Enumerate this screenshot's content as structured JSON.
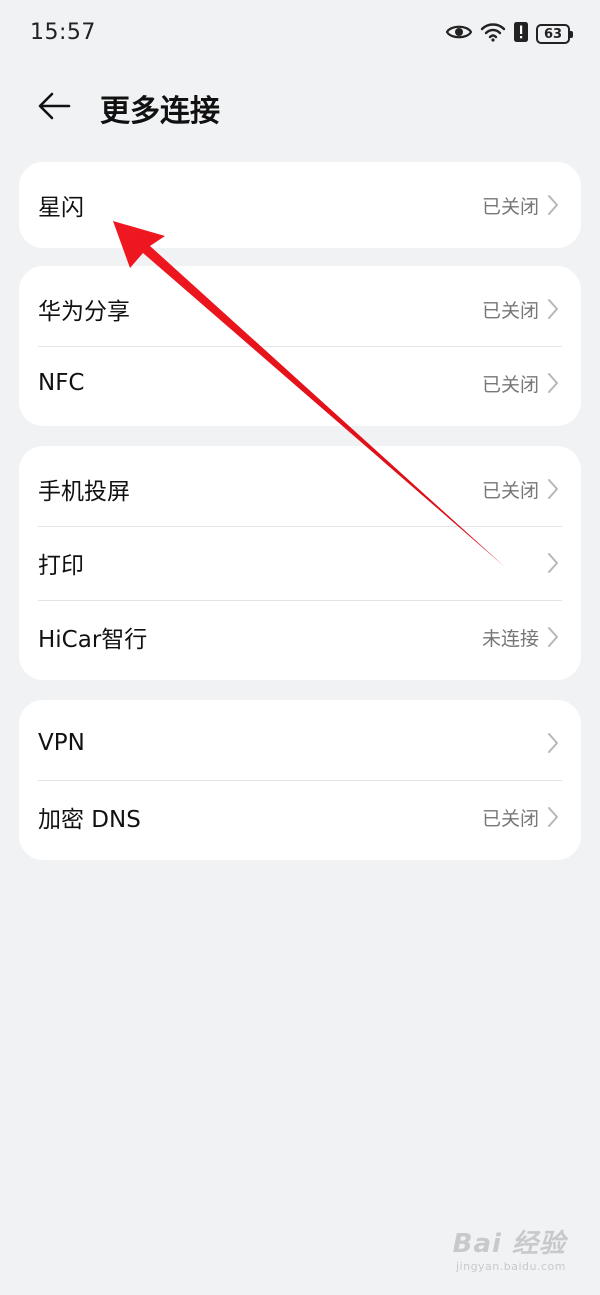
{
  "status_bar": {
    "time": "15:57",
    "battery": "63",
    "icons": [
      "eye-icon",
      "wifi-icon",
      "alert-icon",
      "battery-icon"
    ]
  },
  "header": {
    "title": "更多连接",
    "back_icon": "back-arrow-icon"
  },
  "groups": [
    {
      "items": [
        {
          "label": "星闪",
          "status": "已关闭"
        }
      ]
    },
    {
      "items": [
        {
          "label": "华为分享",
          "status": "已关闭"
        },
        {
          "label": "NFC",
          "status": "已关闭"
        }
      ]
    },
    {
      "items": [
        {
          "label": "手机投屏",
          "status": "已关闭"
        },
        {
          "label": "打印",
          "status": ""
        },
        {
          "label": "HiCar智行",
          "status": "未连接"
        }
      ]
    },
    {
      "items": [
        {
          "label": "VPN",
          "status": ""
        },
        {
          "label": "加密 DNS",
          "status": "已关闭"
        }
      ]
    }
  ],
  "annotation": {
    "color": "#e8141c",
    "points_to": "星闪"
  },
  "watermark": {
    "main": "Bai 经验",
    "url": "jingyan.baidu.com"
  }
}
